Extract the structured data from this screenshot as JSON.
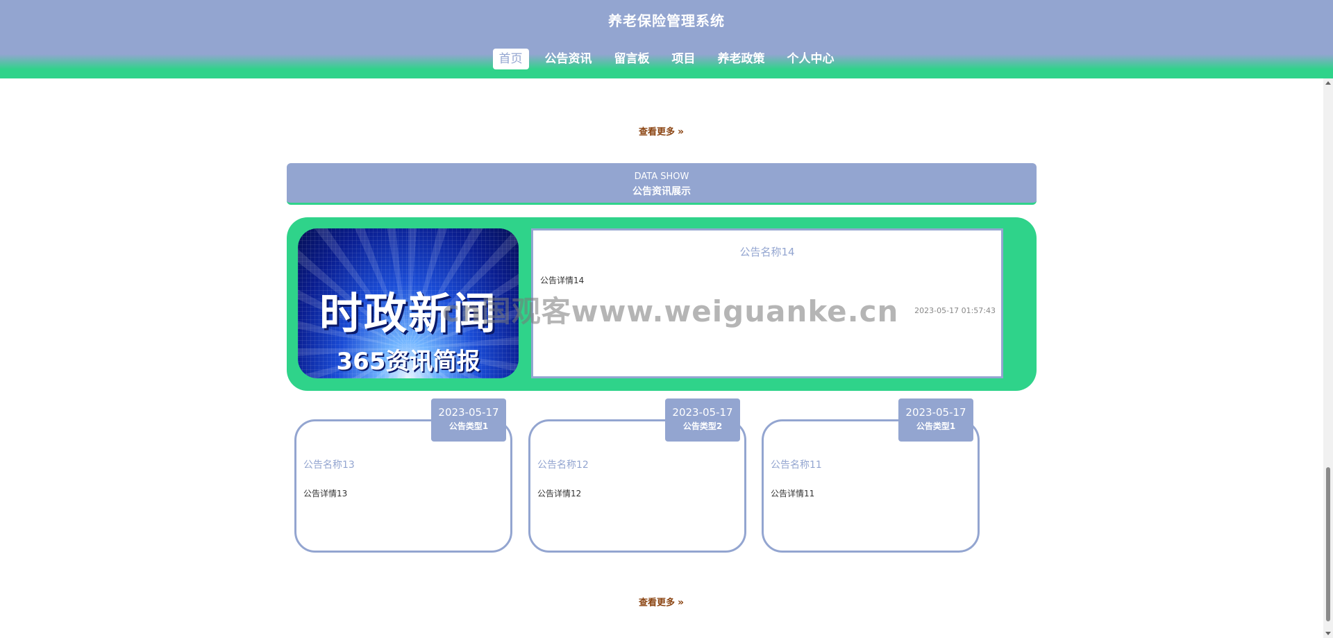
{
  "header": {
    "title": "养老保险管理系统",
    "nav": [
      {
        "label": "首页",
        "active": true
      },
      {
        "label": "公告资讯"
      },
      {
        "label": "留言板"
      },
      {
        "label": "项目"
      },
      {
        "label": "养老政策"
      },
      {
        "label": "个人中心"
      }
    ]
  },
  "more_link_label": "查看更多",
  "more_link_arrows": "»",
  "section": {
    "en_title": "DATA SHOW",
    "cn_title": "公告资讯展示"
  },
  "featured": {
    "image_text_main": "时政新闻",
    "image_text_sub": "365资讯简报",
    "title": "公告名称14",
    "detail": "公告详情14",
    "date": "2023-05-17 01:57:43"
  },
  "cards": [
    {
      "date": "2023-05-17",
      "type": "公告类型1",
      "title": "公告名称13",
      "detail": "公告详情13"
    },
    {
      "date": "2023-05-17",
      "type": "公告类型2",
      "title": "公告名称12",
      "detail": "公告详情12"
    },
    {
      "date": "2023-05-17",
      "type": "公告类型1",
      "title": "公告名称11",
      "detail": "公告详情11"
    }
  ],
  "watermark": "cn国观客www.weiguanke.cn",
  "colors": {
    "primary": "#93a5d0",
    "accent_green": "#2fd38a",
    "more_link": "#8b4513"
  }
}
